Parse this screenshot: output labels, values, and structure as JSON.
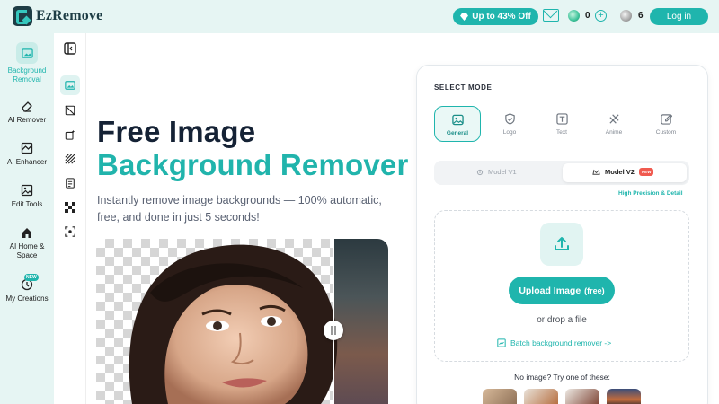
{
  "brand": {
    "name": "EzRemove"
  },
  "topbar": {
    "promo_label": "Up to 43% Off",
    "credits_green": "0",
    "credits_silver": "6",
    "login_label": "Log in"
  },
  "leftnav": {
    "items": [
      {
        "label_line1": "Background",
        "label_line2": "Removal"
      },
      {
        "label_line1": "AI Remover",
        "label_line2": ""
      },
      {
        "label_line1": "AI Enhancer",
        "label_line2": ""
      },
      {
        "label_line1": "Edit Tools",
        "label_line2": ""
      },
      {
        "label_line1": "AI Home &",
        "label_line2": "Space"
      },
      {
        "label_line1": "My Creations",
        "label_line2": ""
      }
    ],
    "new_badge": "NEW"
  },
  "hero": {
    "title_line1": "Free Image",
    "title_line2": "Background Remover",
    "subtitle": "Instantly remove image backgrounds — 100% automatic, free, and done in just 5 seconds!"
  },
  "panel": {
    "select_mode_label": "SELECT MODE",
    "modes": [
      "General",
      "Logo",
      "Text",
      "Anime",
      "Custom"
    ],
    "model_v1": "Model V1",
    "model_v2": "Model V2",
    "model_v2_badge": "NEW",
    "high_precision": "High Precision & Detail",
    "upload_label": "Upload Image",
    "upload_free": "(free)",
    "drop_label": "or drop a file",
    "batch_label": "Batch background remover ->",
    "no_image_label": "No image? Try one of these:"
  },
  "colors": {
    "accent": "#1fb5ad",
    "sidebar_bg": "#e6f5f3",
    "title_dark": "#152235",
    "new_red": "#f05a4f"
  }
}
